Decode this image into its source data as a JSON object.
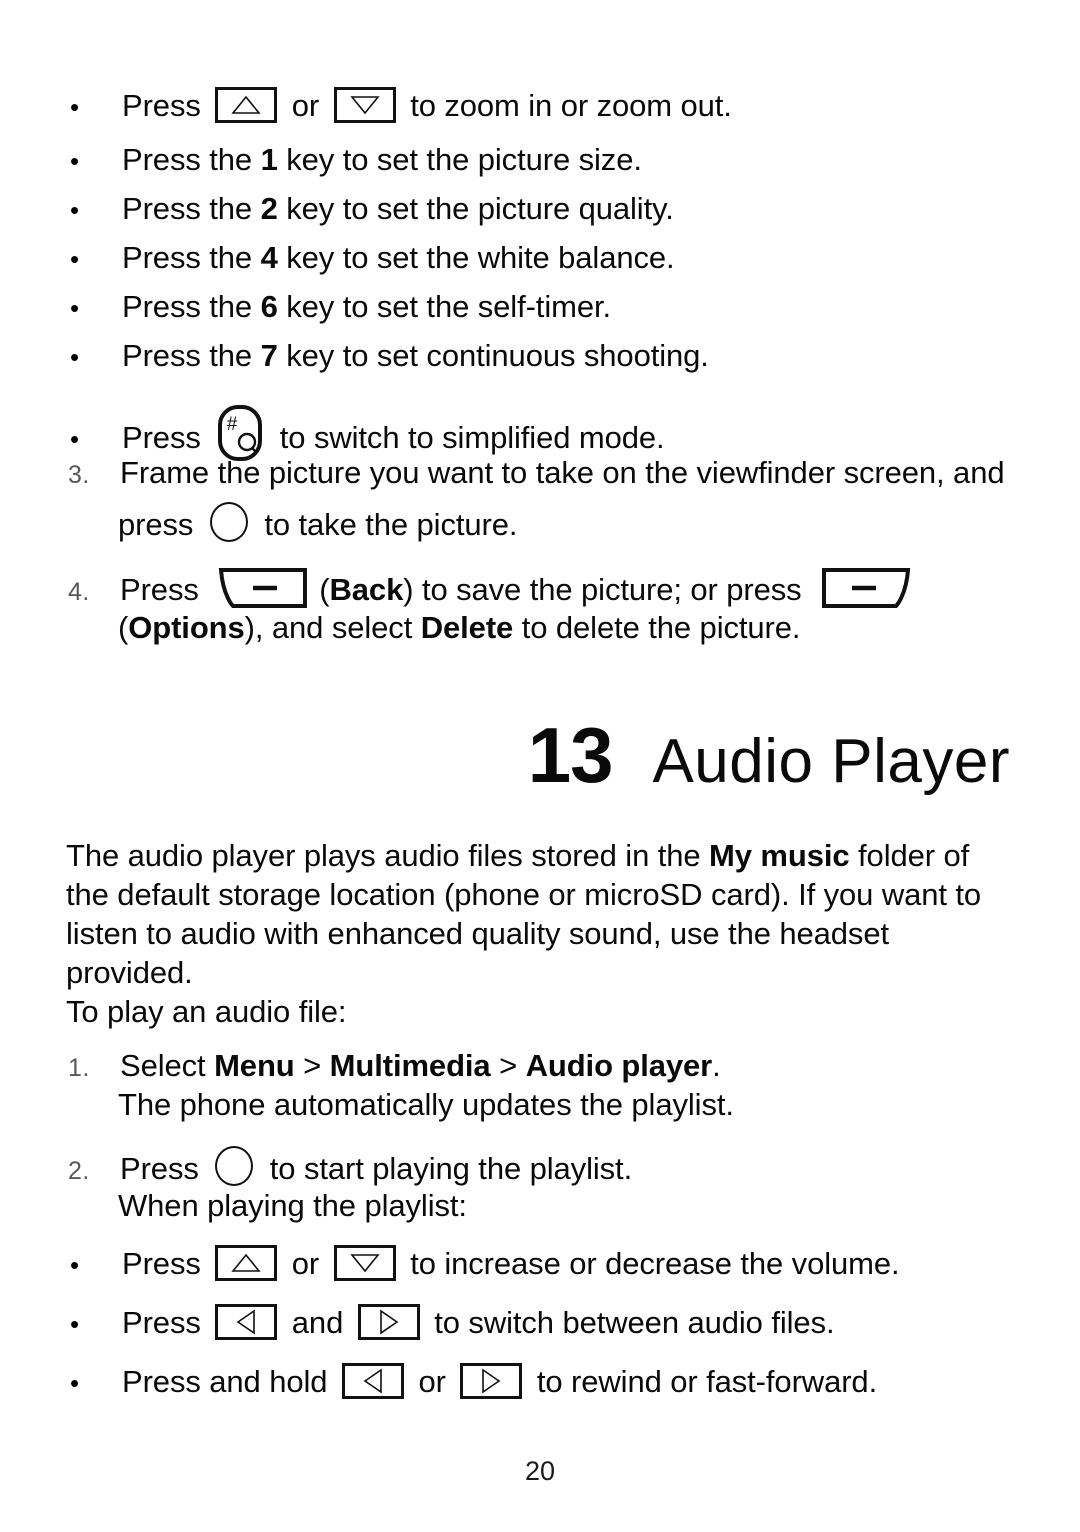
{
  "document": {
    "page_number": "20"
  },
  "camera_section": {
    "bullets": [
      {
        "id": "zoom",
        "text_before": "Press",
        "icon1": "key-up-icon",
        "text_mid": "or",
        "icon2": "key-down-icon",
        "text_after": "to zoom in or zoom out."
      },
      {
        "id": "picture-size",
        "text_before": "Press the",
        "key": "1",
        "text_after": "key to set the picture size."
      },
      {
        "id": "picture-quality",
        "text_before": "Press the",
        "key": "2",
        "text_after": "key to set the picture quality."
      },
      {
        "id": "white-balance",
        "text_before": "Press the",
        "key": "4",
        "text_after": "key to set the white balance."
      },
      {
        "id": "self-timer",
        "text_before": "Press the",
        "key": "6",
        "text_after": "key to set the self-timer."
      },
      {
        "id": "continuous-shooting",
        "text_before": "Press the",
        "key": "7",
        "text_after": "key to set continuous shooting."
      },
      {
        "id": "simplified-mode",
        "text_before": "Press",
        "icon1": "key-hash-icon",
        "text_after": "to switch to simplified mode."
      }
    ],
    "steps": [
      {
        "number": "3.",
        "line1": "Frame the picture you want to take on the viewfinder screen, and",
        "line2_before": "press",
        "line2_icon": "key-ok-circle-icon",
        "line2_after": "to take the picture."
      },
      {
        "number": "4.",
        "line1_before": "Press",
        "line1_icon1": "softkey-left-icon",
        "line1_mid1": "(",
        "line1_bold1": "Back",
        "line1_mid2": ") to save the picture; or press",
        "line1_icon2": "softkey-right-icon",
        "line2_open": "(",
        "line2_bold1": "Options",
        "line2_mid": "), and select",
        "line2_bold2": "Delete",
        "line2_end": "to delete the picture."
      }
    ]
  },
  "chapter": {
    "number": "13",
    "title": "Audio Player"
  },
  "audio_section": {
    "intro_part1": "The audio player plays audio files stored in the ",
    "intro_bold": "My music",
    "intro_part2": " folder of the default storage location (phone or microSD card). If you want to listen to audio with enhanced quality sound, use the headset provided.",
    "lead_in": "To play an audio file:",
    "steps": [
      {
        "number": "1.",
        "line1_before": "Select ",
        "line1_bold1": "Menu",
        "line1_sep1": " > ",
        "line1_bold2": "Multimedia",
        "line1_sep2": " > ",
        "line1_bold3": "Audio player",
        "line1_end": ".",
        "line2": "The phone automatically updates the playlist."
      },
      {
        "number": "2.",
        "line1_before": "Press",
        "line1_icon": "key-ok-circle-icon",
        "line1_after": "to start playing the playlist.",
        "line2": "When playing the playlist:"
      }
    ],
    "bullets": [
      {
        "id": "volume",
        "text_before": "Press",
        "icon1": "key-up-icon",
        "text_mid": "or",
        "icon2": "key-down-icon",
        "text_after": "to increase or decrease the volume."
      },
      {
        "id": "switch-files",
        "text_before": "Press",
        "icon1": "key-left-icon",
        "text_mid": "and",
        "icon2": "key-right-icon",
        "text_after": "to switch between audio files."
      },
      {
        "id": "rewind-forward",
        "text_before": "Press and hold",
        "icon1": "key-left-icon",
        "text_mid": "or",
        "icon2": "key-right-icon",
        "text_after": "to rewind or fast-forward."
      }
    ]
  },
  "glyphs": {
    "bullet": "•",
    "hash": "#",
    "q": "Q",
    "dash": "–"
  }
}
